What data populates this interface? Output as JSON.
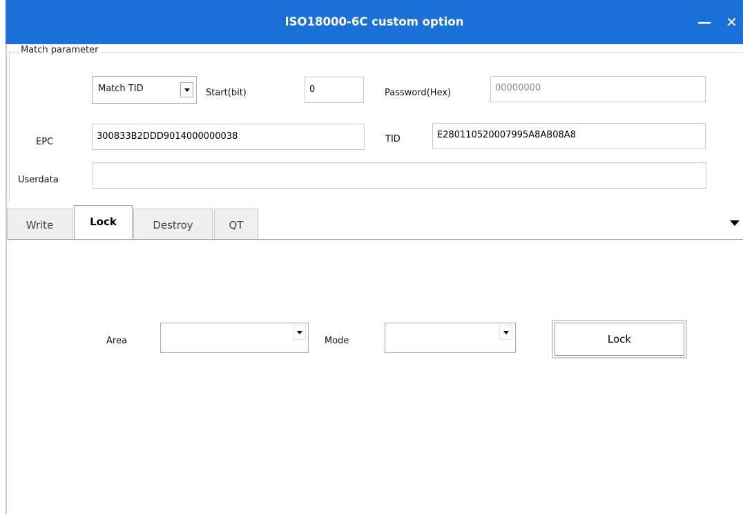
{
  "window": {
    "title": "ISO18000-6C custom option",
    "minimize_label": "—",
    "close_label": "✕"
  },
  "match": {
    "legend": "Match parameter",
    "match_type": "Match TID",
    "start_label": "Start(bit)",
    "start_value": "0",
    "password_label": "Password(Hex)",
    "password_value": "00000000",
    "epc_label": "EPC",
    "epc_value": "300833B2DDD9014000000038",
    "tid_label": "TID",
    "tid_value": "E280110520007995A8AB08A8",
    "userdata_label": "Userdata",
    "userdata_value": ""
  },
  "tabs": [
    {
      "label": "Write",
      "active": false
    },
    {
      "label": "Lock",
      "active": true
    },
    {
      "label": "Destroy",
      "active": false
    },
    {
      "label": "QT",
      "active": false
    }
  ],
  "lock": {
    "area_label": "Area",
    "area_value": "",
    "mode_label": "Mode",
    "mode_value": "",
    "lock_button": "Lock"
  },
  "colors": {
    "titlebar": "#1a70d6"
  },
  "icons": {
    "dropdown": "chevron-down-icon",
    "tab_overflow": "caret-down-icon"
  }
}
